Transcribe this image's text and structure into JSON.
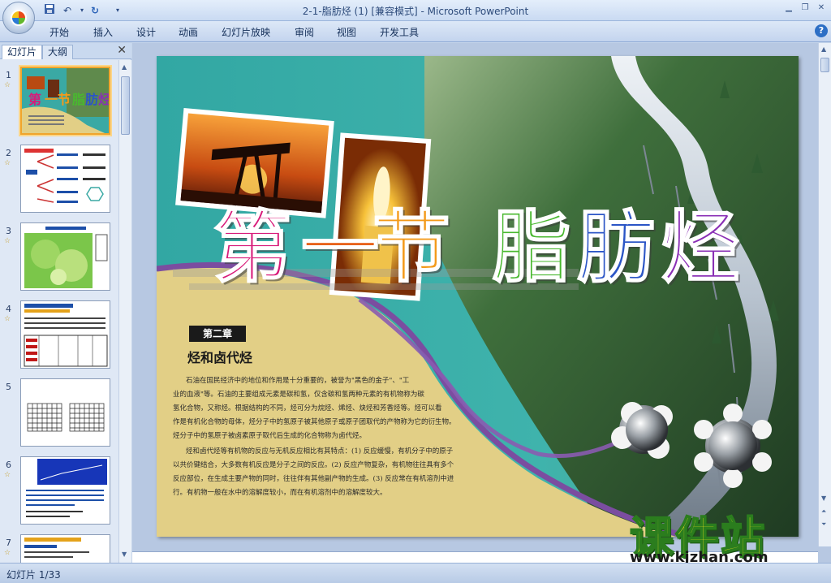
{
  "window": {
    "title": "2-1-脂肪烃 (1) [兼容模式] - Microsoft PowerPoint"
  },
  "ribbon": {
    "tabs": [
      "开始",
      "插入",
      "设计",
      "动画",
      "幻灯片放映",
      "审阅",
      "视图",
      "开发工具"
    ]
  },
  "left_panel": {
    "tab_slides": "幻灯片",
    "tab_outline": "大纲",
    "close_glyph": "✕",
    "thumbnails": [
      {
        "num": "1",
        "star": "☆"
      },
      {
        "num": "2",
        "star": "☆"
      },
      {
        "num": "3",
        "star": "☆"
      },
      {
        "num": "4",
        "star": "☆"
      },
      {
        "num": "5",
        "star": ""
      },
      {
        "num": "6",
        "star": "☆"
      },
      {
        "num": "7",
        "star": "☆"
      }
    ]
  },
  "slide": {
    "title_chars": [
      "第",
      "一",
      "节",
      "脂",
      "肪",
      "烃"
    ],
    "chapter_label": "第二章",
    "chapter_subtitle": "烃和卤代烃",
    "paragraph_lines": [
      "石油在国民经济中的地位和作用是十分重要的，被誉为\"黑色的金子\"、\"工",
      "业的血液\"等。石油的主要组成元素是碳和氢，仅含碳和氢两种元素的有机物称为碳",
      "氢化合物，又称烃。根据结构的不同，烃可分为烷烃、烯烃、炔烃和芳香烃等。烃可以看",
      "作是有机化合物的母体，烃分子中的氢原子被其他原子或原子团取代的产物称为它的衍生物。",
      "烃分子中的氢原子被卤素原子取代后生成的化合物称为卤代烃。",
      "烃和卤代烃等有机物的反应与无机反应相比有其特点：(1) 反应缓慢，有机分子中的原子",
      "以共价键结合，大多数有机反应是分子之间的反应。(2) 反应产物复杂，有机物往往具有多个",
      "反应部位，在生成主要产物的同时，往往伴有其他副产物的生成。(3) 反应常在有机溶剂中进",
      "行。有机物一般在水中的溶解度较小，而在有机溶剂中的溶解度较大。"
    ]
  },
  "watermark": {
    "cn": "课件站",
    "url": "www.kjzhan.com"
  },
  "status": {
    "slide_counter": "幻灯片 1/33"
  },
  "colors": {
    "teal": "#3aa9a4",
    "sand": "#e2cf86",
    "purple_band": "#7b4da0",
    "title_magenta": "#d81b7a",
    "title_orange": "#f39a1a",
    "title_green": "#49b82f",
    "title_blue": "#2b55c6",
    "title_violet": "#8a2fb5"
  }
}
